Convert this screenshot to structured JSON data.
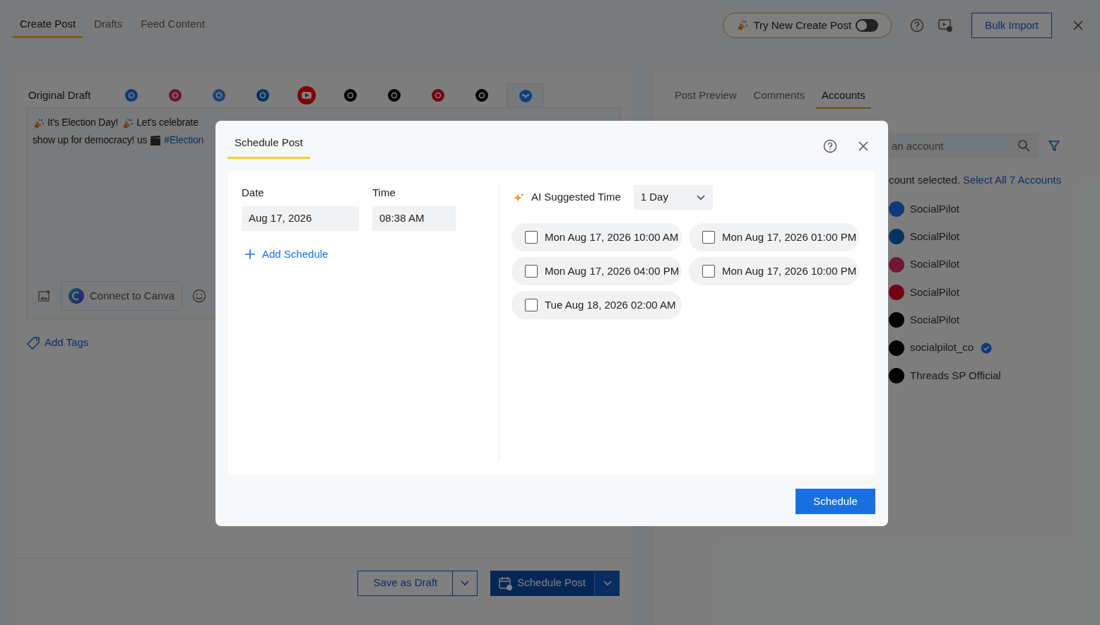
{
  "header": {
    "tabs": [
      {
        "label": "Create Post",
        "selected": true
      },
      {
        "label": "Drafts",
        "selected": false
      },
      {
        "label": "Feed Content",
        "selected": false
      }
    ],
    "toggle": {
      "label": "Try New Create Post",
      "on": false
    },
    "bulk_import": "Bulk Import"
  },
  "editor": {
    "tabs": [
      {
        "kind": "text",
        "label": "Original Draft",
        "selected": false
      },
      {
        "kind": "facebook",
        "selected": false
      },
      {
        "kind": "instagram",
        "selected": false
      },
      {
        "kind": "google",
        "selected": false
      },
      {
        "kind": "linkedin",
        "selected": false
      },
      {
        "kind": "youtube",
        "selected": false
      },
      {
        "kind": "tiktok",
        "selected": false
      },
      {
        "kind": "x",
        "selected": false
      },
      {
        "kind": "pinterest",
        "selected": false
      },
      {
        "kind": "threads",
        "selected": false
      },
      {
        "kind": "bluesky",
        "selected": true
      }
    ],
    "line_1": "It's Election Day!",
    "line_1b": "Let's celebrate",
    "line_2": "show up for democracy! us",
    "hashtag": "#Election",
    "canva": "Connect to Canva",
    "add_tags": "Add Tags"
  },
  "preview": {
    "tabs": [
      {
        "label": "Post Preview",
        "selected": false
      },
      {
        "label": "Comments",
        "selected": false
      },
      {
        "label": "Accounts",
        "selected": true
      }
    ],
    "search_placeholder": "an account",
    "selected_note": "count selected.",
    "select_all": "Select All 7 Accounts",
    "accounts": [
      {
        "name": "SocialPilot",
        "color": "#0c3b79"
      },
      {
        "name": "SocialPilot",
        "color": "#053361"
      },
      {
        "name": "SocialPilot",
        "color": "#701836"
      },
      {
        "name": "SocialPilot",
        "color": "#730012"
      },
      {
        "name": "SocialPilot",
        "color": "#000000"
      },
      {
        "name": "socialpilot_co",
        "color": "#000000",
        "verified": true
      },
      {
        "name": "Threads SP Official",
        "color": "#000000"
      }
    ]
  },
  "footer": {
    "save_draft": "Save as Draft",
    "schedule_post": "Schedule Post"
  },
  "modal": {
    "tab": "Schedule Post",
    "date_label": "Date",
    "date": "Aug 17, 2026",
    "time_label": "Time",
    "time": "08:38 AM",
    "add_schedule": "Add Schedule",
    "ai_label": "AI Suggested Time",
    "range": "1 Day",
    "slots": [
      {
        "label": "Mon Aug 17, 2026 10:00 AM",
        "checked": false
      },
      {
        "label": "Mon Aug 17, 2026 01:00 PM",
        "checked": false
      },
      {
        "label": "Mon Aug 17, 2026 04:00 PM",
        "checked": false
      },
      {
        "label": "Mon Aug 17, 2026 10:00 PM",
        "checked": false
      },
      {
        "label": "Tue Aug 18, 2026 02:00 AM",
        "checked": false
      }
    ],
    "schedule": "Schedule"
  }
}
